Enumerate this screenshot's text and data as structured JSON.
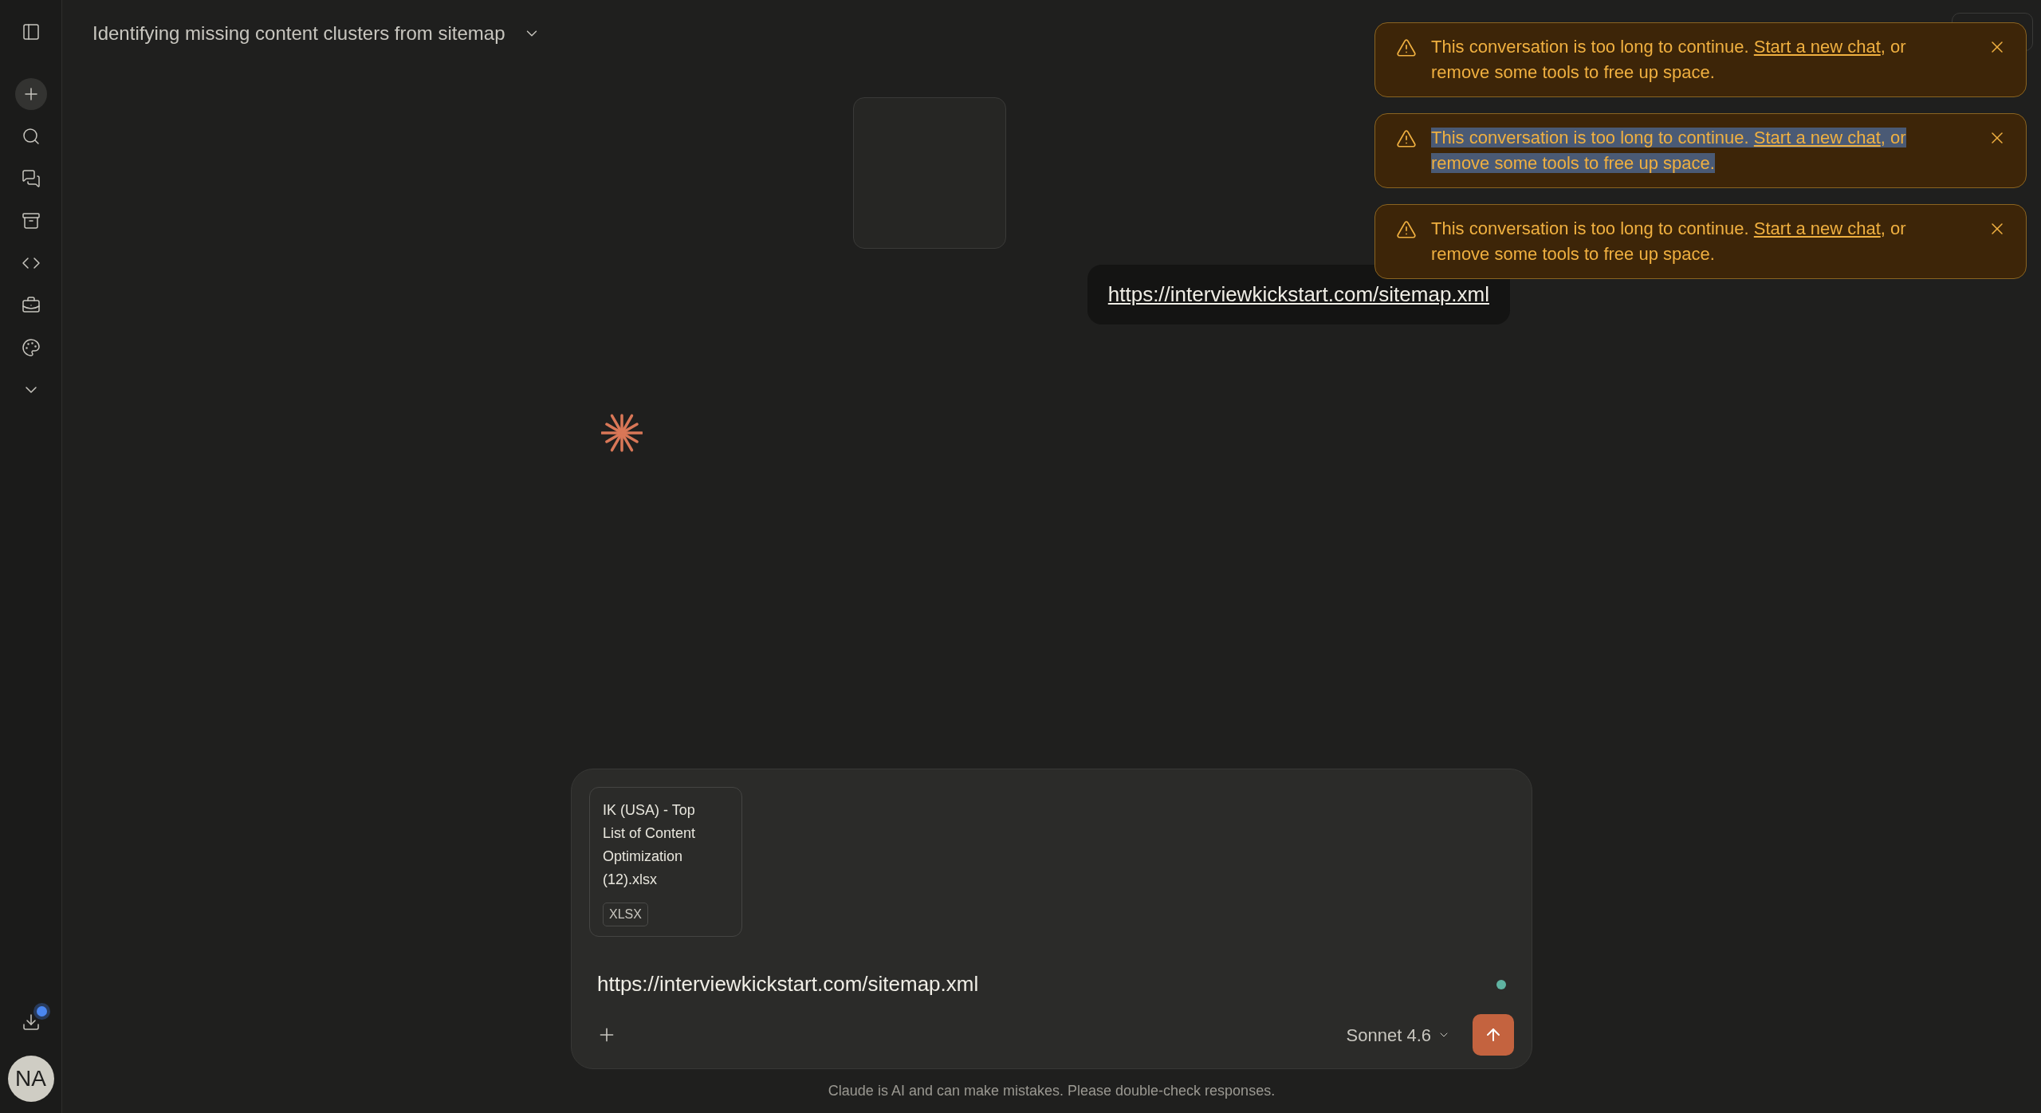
{
  "header": {
    "title": "Identifying missing content clusters from sitemap"
  },
  "sidebar": {
    "avatar": "NA",
    "download_badge": true
  },
  "alerts": [
    {
      "text": "This conversation is too long to continue.",
      "link": "Start a new chat",
      "rest": ", or remove some tools to free up space.",
      "selected": false
    },
    {
      "text": "This conversation is too long to continue.",
      "link": "Start a new chat",
      "rest": ", or remove some tools to free up space.",
      "selected": true
    },
    {
      "text": "This conversation is too long to continue.",
      "link": "Start a new chat",
      "rest": ", or remove some tools to free up space.",
      "selected": false
    }
  ],
  "message": {
    "link": "https://interviewkickstart.com/sitemap.xml"
  },
  "composer": {
    "attachment": {
      "name": "IK (USA) - Top List of Content Optimization (12).xlsx",
      "type": "XLSX"
    },
    "value": "https://interviewkickstart.com/sitemap.xml",
    "model": "Sonnet 4.6"
  },
  "footer": "Claude is AI and can make mistakes. Please double-check responses."
}
